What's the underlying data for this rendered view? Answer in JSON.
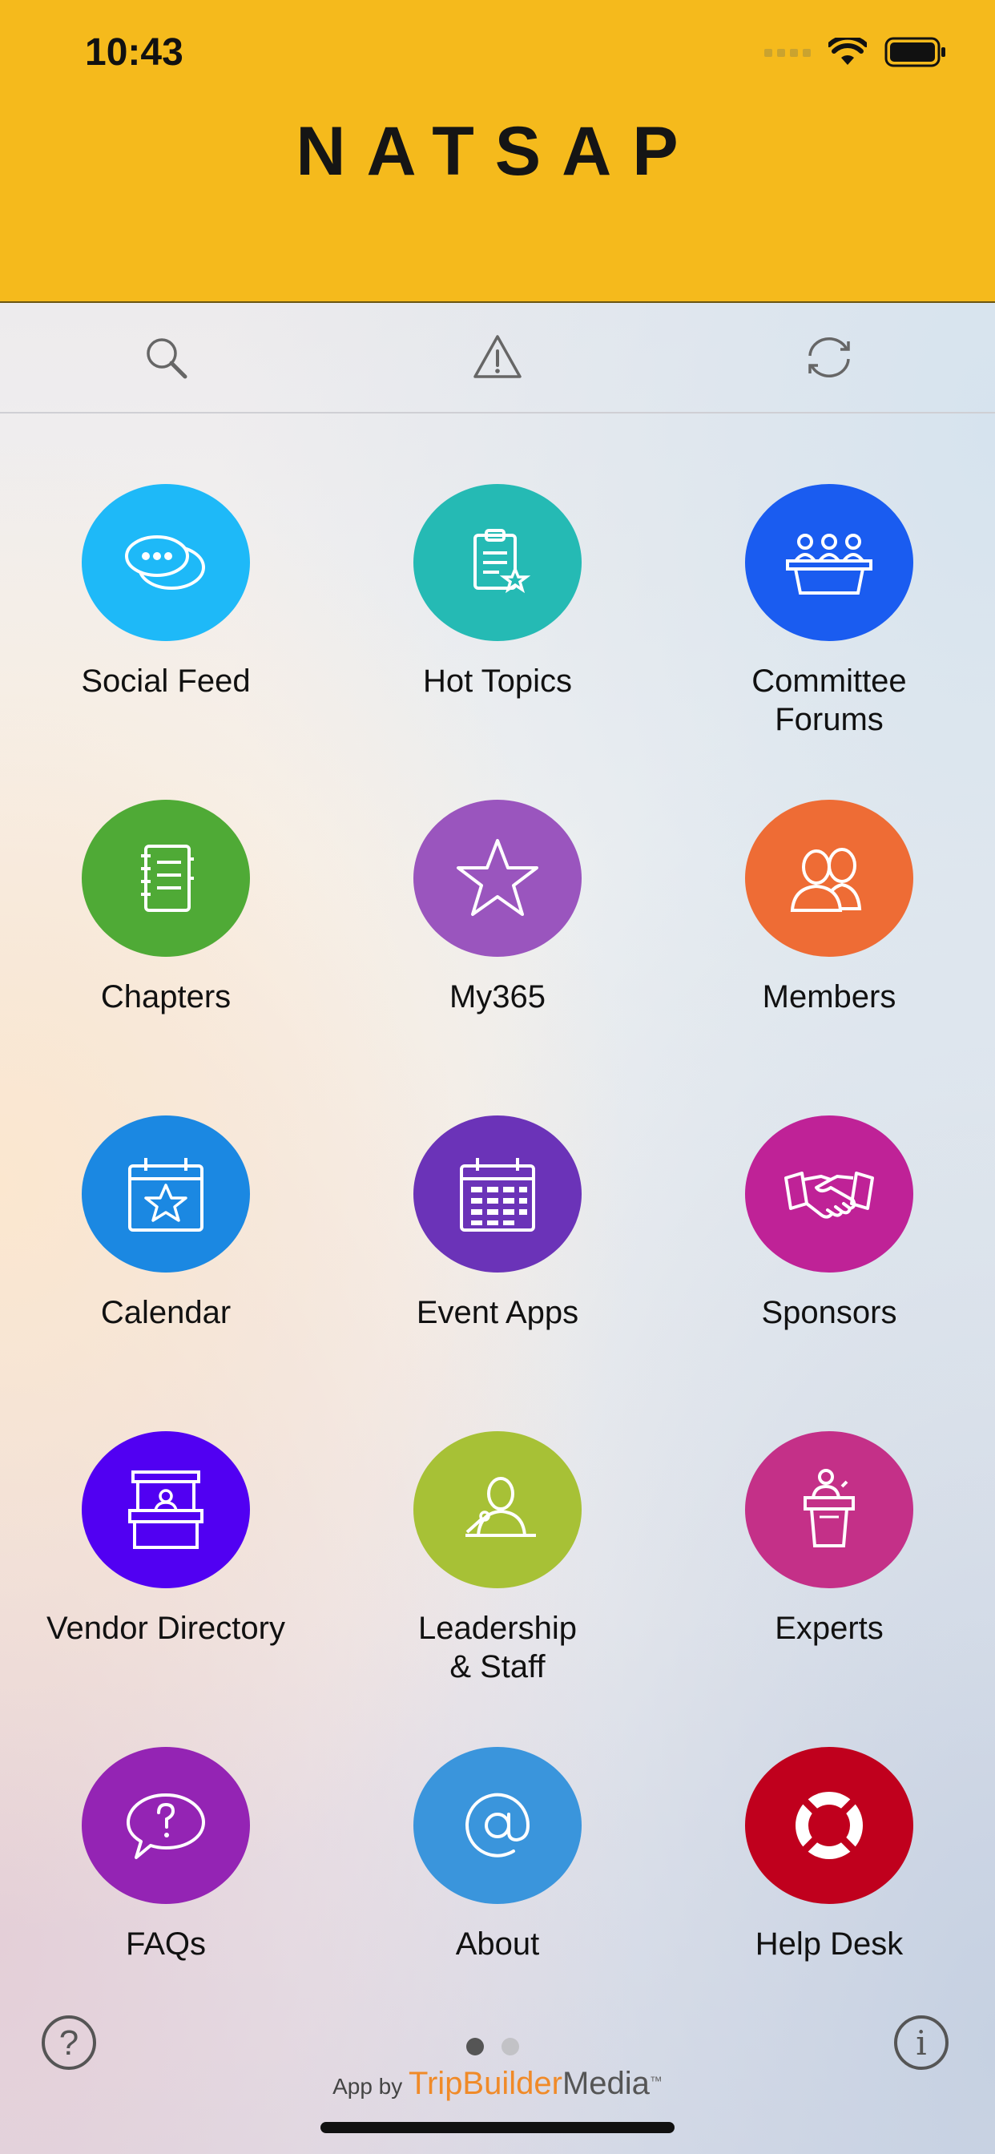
{
  "status_bar": {
    "time": "10:43"
  },
  "header": {
    "logo": "NATSAP"
  },
  "toolbar": {
    "search_icon": "search-icon",
    "alert_icon": "alert-icon",
    "refresh_icon": "refresh-icon"
  },
  "tiles": [
    {
      "label": "Social Feed",
      "icon": "chat-bubbles-icon",
      "color": "#1eb9f8"
    },
    {
      "label": "Hot Topics",
      "icon": "clipboard-star-icon",
      "color": "#25bab4"
    },
    {
      "label": "Committee\nForums",
      "icon": "panel-icon",
      "color": "#1a5cf0"
    },
    {
      "label": "Chapters",
      "icon": "notebook-icon",
      "color": "#4faa36"
    },
    {
      "label": "My365",
      "icon": "star-icon",
      "color": "#9a55be"
    },
    {
      "label": "Members",
      "icon": "people-icon",
      "color": "#ee6c35"
    },
    {
      "label": "Calendar",
      "icon": "calendar-star-icon",
      "color": "#1b88e2"
    },
    {
      "label": "Event Apps",
      "icon": "calendar-grid-icon",
      "color": "#6b33b8"
    },
    {
      "label": "Sponsors",
      "icon": "handshake-icon",
      "color": "#bf2297"
    },
    {
      "label": "Vendor Directory",
      "icon": "booth-icon",
      "color": "#5100f2"
    },
    {
      "label": "Leadership\n& Staff",
      "icon": "speaker-icon",
      "color": "#a7c136"
    },
    {
      "label": "Experts",
      "icon": "podium-icon",
      "color": "#c43088"
    },
    {
      "label": "FAQs",
      "icon": "question-bubble-icon",
      "color": "#9424b4"
    },
    {
      "label": "About",
      "icon": "at-icon",
      "color": "#3a95dc"
    },
    {
      "label": "Help Desk",
      "icon": "lifebuoy-icon",
      "color": "#c0001d"
    }
  ],
  "footer": {
    "help_symbol": "?",
    "info_symbol": "i",
    "credit_prefix": "App by",
    "credit_brand": "TripBuilder",
    "credit_brand_suffix": "Media",
    "credit_tm": "™",
    "page_dots": {
      "count": 2,
      "active": 0
    }
  }
}
